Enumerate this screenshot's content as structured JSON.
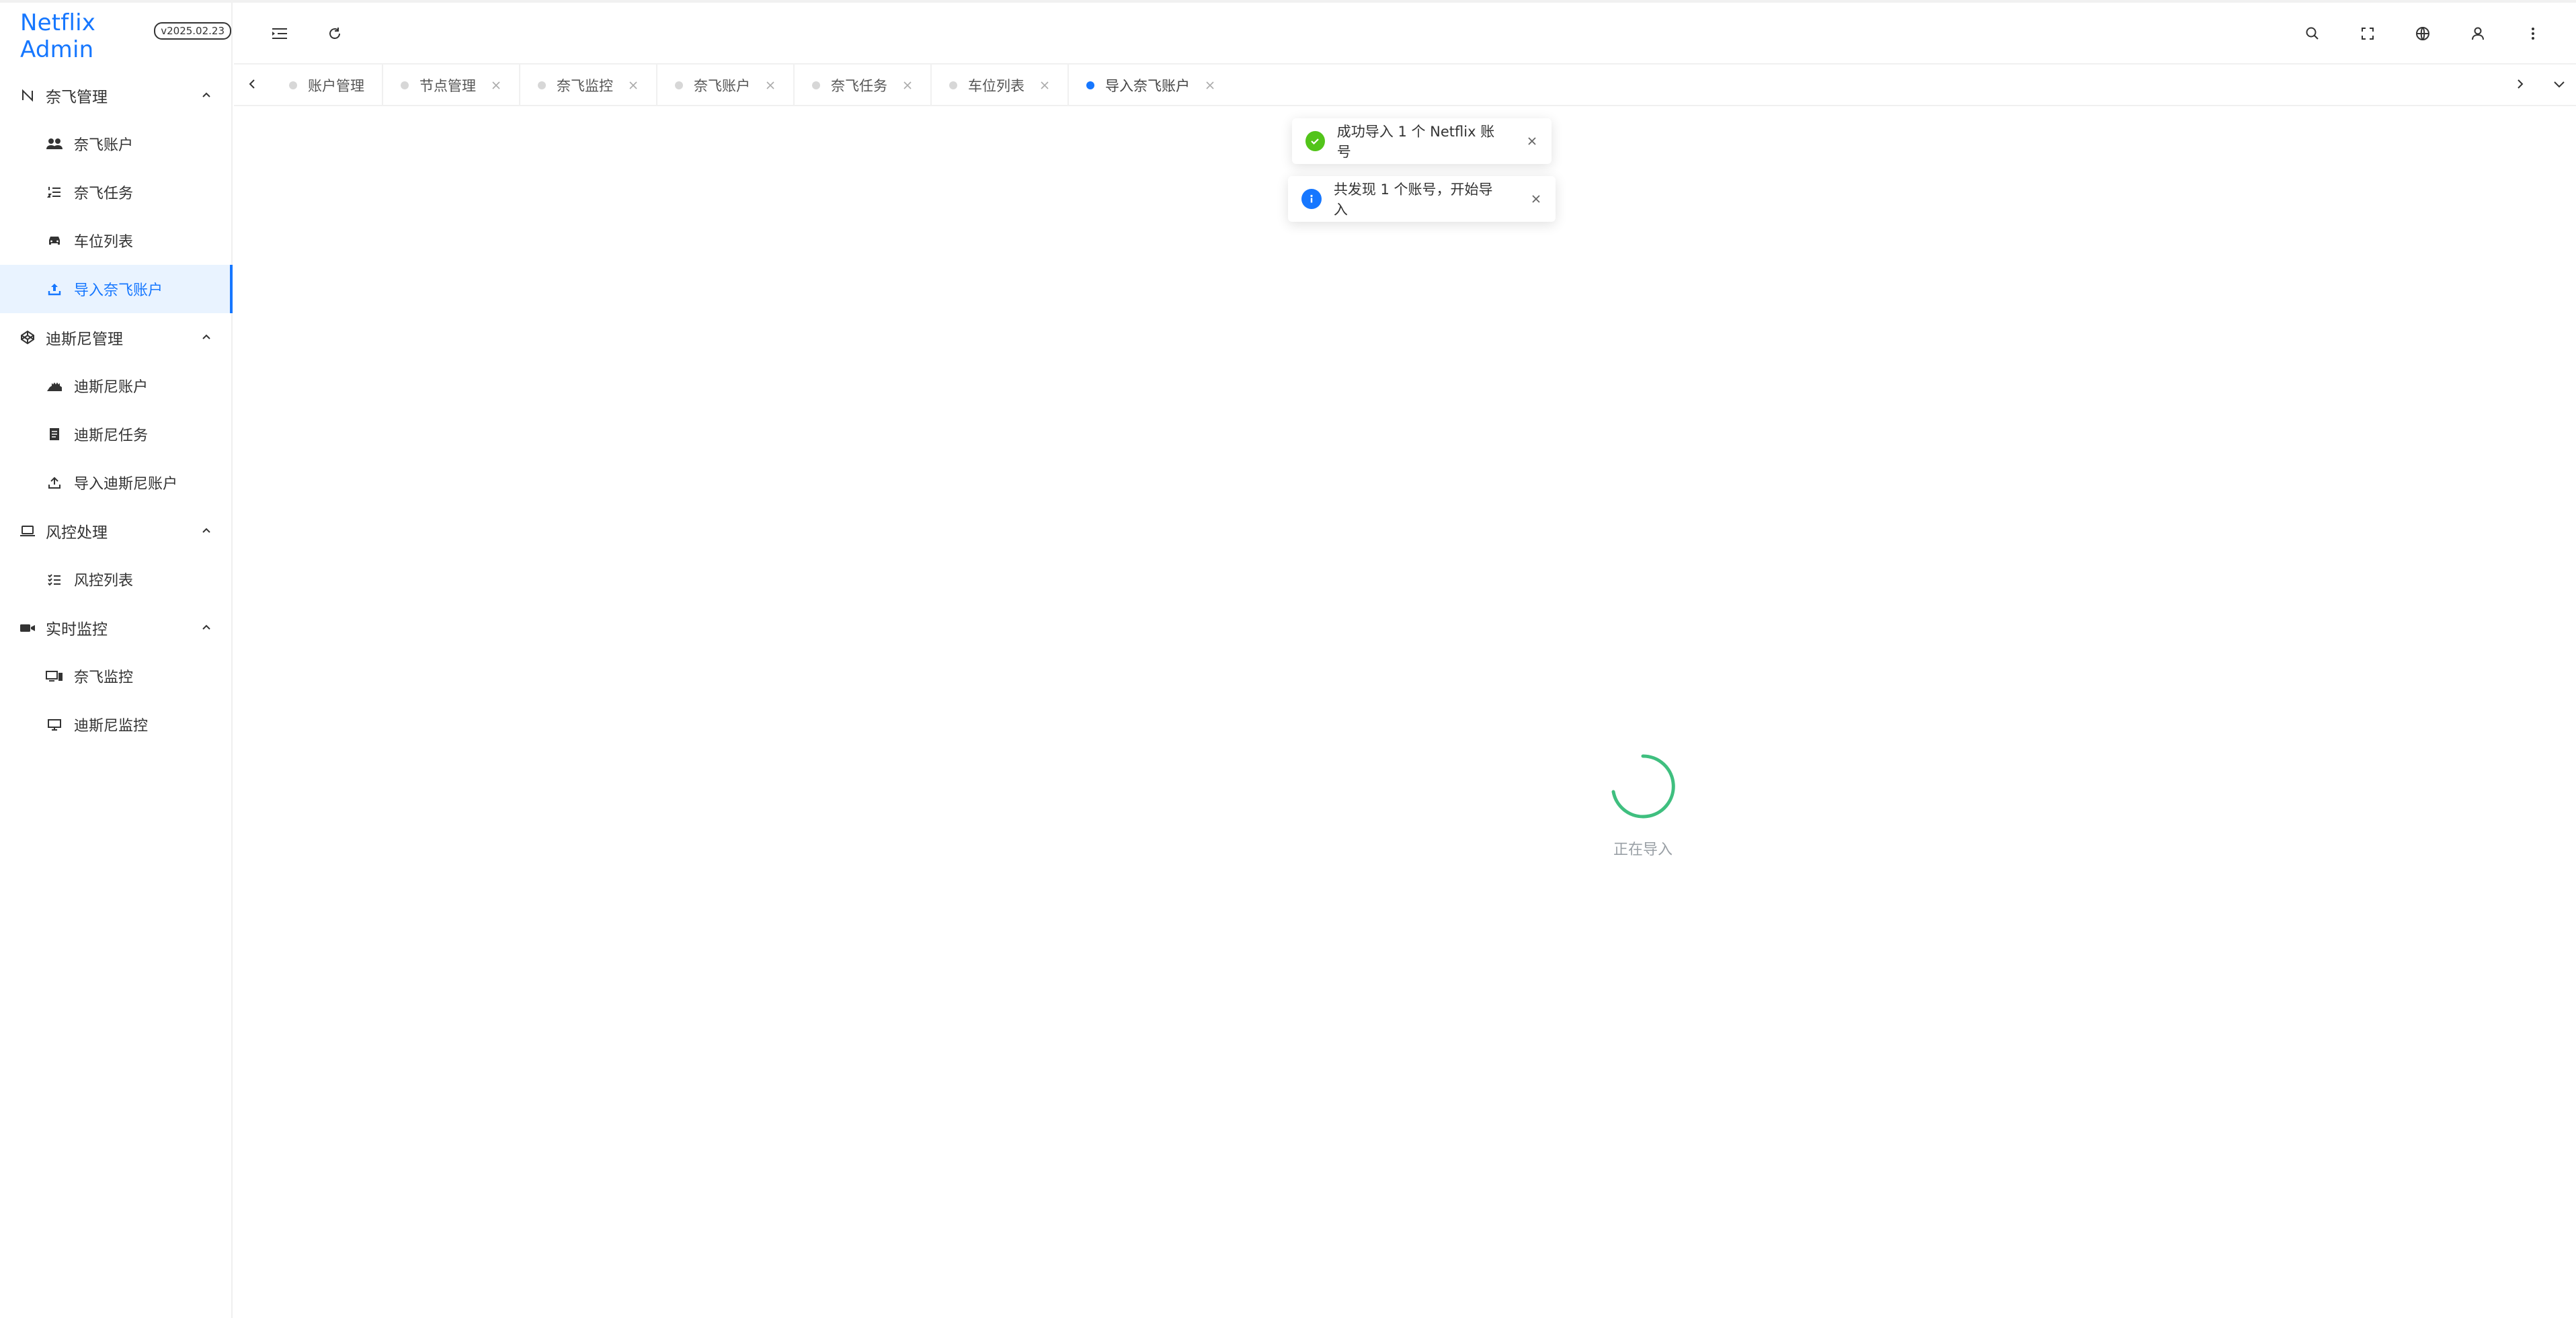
{
  "app": {
    "title": "Netflix Admin",
    "version": "v2025.02.23"
  },
  "sidebar": {
    "groups": [
      {
        "label": "奈飞管理",
        "items": [
          {
            "label": "奈飞账户",
            "icon": "users-icon"
          },
          {
            "label": "奈飞任务",
            "icon": "ordered-list-icon"
          },
          {
            "label": "车位列表",
            "icon": "car-icon"
          },
          {
            "label": "导入奈飞账户",
            "icon": "upload-icon",
            "active": true
          }
        ],
        "icon": "letter-n-icon"
      },
      {
        "label": "迪斯尼管理",
        "items": [
          {
            "label": "迪斯尼账户",
            "icon": "castle-icon"
          },
          {
            "label": "迪斯尼任务",
            "icon": "document-icon"
          },
          {
            "label": "导入迪斯尼账户",
            "icon": "upload-icon"
          }
        ],
        "icon": "codepen-icon"
      },
      {
        "label": "风控处理",
        "items": [
          {
            "label": "风控列表",
            "icon": "checklist-icon"
          }
        ],
        "icon": "laptop-icon"
      },
      {
        "label": "实时监控",
        "items": [
          {
            "label": "奈飞监控",
            "icon": "devices-icon"
          },
          {
            "label": "迪斯尼监控",
            "icon": "monitor-icon"
          }
        ],
        "icon": "video-icon"
      }
    ]
  },
  "tabs": [
    {
      "label": "账户管理",
      "closable": false
    },
    {
      "label": "节点管理",
      "closable": true
    },
    {
      "label": "奈飞监控",
      "closable": true
    },
    {
      "label": "奈飞账户",
      "closable": true
    },
    {
      "label": "奈飞任务",
      "closable": true
    },
    {
      "label": "车位列表",
      "closable": true
    },
    {
      "label": "导入奈飞账户",
      "closable": true,
      "active": true
    }
  ],
  "notifications": [
    {
      "type": "success",
      "text": "成功导入 1 个 Netflix 账号"
    },
    {
      "type": "info",
      "text": "共发现 1 个账号，开始导入"
    }
  ],
  "loading": {
    "text": "正在导入"
  },
  "colors": {
    "accent": "#1677ff",
    "success": "#52c41a",
    "info": "#1677ff",
    "spinner": "#3fbf7f"
  }
}
